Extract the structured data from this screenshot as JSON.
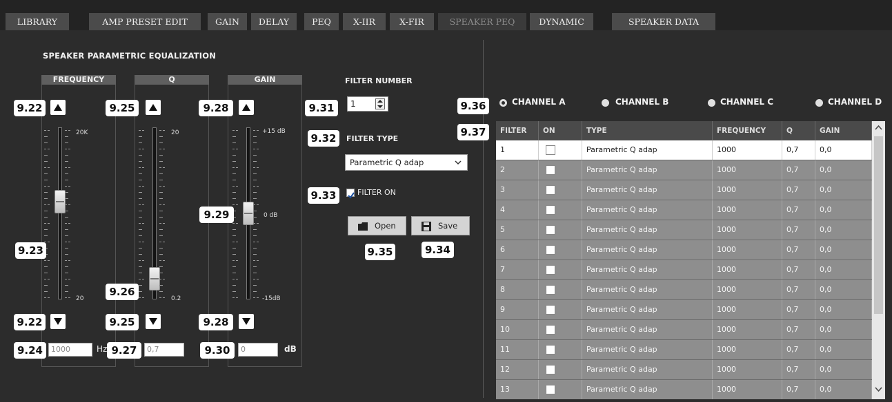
{
  "tabs": [
    {
      "label": "LIBRARY"
    },
    {
      "label": "AMP PRESET EDIT"
    },
    {
      "label": "GAIN"
    },
    {
      "label": "DELAY"
    },
    {
      "label": "PEQ"
    },
    {
      "label": "X-IIR"
    },
    {
      "label": "X-FIR"
    },
    {
      "label": "SPEAKER PEQ",
      "active": true
    },
    {
      "label": "DYNAMIC"
    },
    {
      "label": "SPEAKER DATA"
    }
  ],
  "section_title": "SPEAKER PARAMETRIC EQUALIZATION",
  "columns": {
    "frequency": {
      "header": "FREQUENCY",
      "scale_top": "20K",
      "scale_bottom": "20",
      "value": "1000",
      "unit": "Hz",
      "level": 0.58
    },
    "q": {
      "header": "Q",
      "scale_top": "20",
      "scale_bottom": "0.2",
      "value": "0,7",
      "unit": "",
      "level": 0.06
    },
    "gain": {
      "header": "GAIN",
      "scale_top": "+15 dB",
      "scale_mid": "0 dB",
      "scale_bottom": "-15dB",
      "value": "0",
      "unit": "dB",
      "level": 0.5
    }
  },
  "callouts": {
    "freq_up": "9.22",
    "freq_slider": "9.23",
    "freq_down": "9.22",
    "freq_value": "9.24",
    "q_up": "9.25",
    "q_slider": "9.26",
    "q_down": "9.25",
    "q_value": "9.27",
    "gain_up": "9.28",
    "gain_slider": "9.29",
    "gain_down": "9.28",
    "gain_value": "9.30",
    "filter_number": "9.31",
    "filter_type": "9.32",
    "filter_on": "9.33",
    "save": "9.34",
    "open": "9.35",
    "channels": "9.36",
    "table": "9.37"
  },
  "filter_number": {
    "label": "FILTER NUMBER",
    "value": "1"
  },
  "filter_type": {
    "label": "FILTER TYPE",
    "value": "Parametric Q adap"
  },
  "filter_on": {
    "label": "FILTER ON",
    "checked": true
  },
  "buttons": {
    "open": "Open",
    "save": "Save"
  },
  "channels": [
    {
      "label": "CHANNEL A",
      "selected": true
    },
    {
      "label": "CHANNEL B",
      "selected": false
    },
    {
      "label": "CHANNEL C",
      "selected": false
    },
    {
      "label": "CHANNEL D",
      "selected": false
    }
  ],
  "table": {
    "headers": [
      "FILTER",
      "ON",
      "TYPE",
      "FREQUENCY",
      "Q",
      "GAIN"
    ],
    "rows": [
      [
        "1",
        "",
        "Parametric Q adap",
        "1000",
        "0,7",
        "0,0"
      ],
      [
        "2",
        "",
        "Parametric Q adap",
        "1000",
        "0,7",
        "0,0"
      ],
      [
        "3",
        "",
        "Parametric Q adap",
        "1000",
        "0,7",
        "0,0"
      ],
      [
        "4",
        "",
        "Parametric Q adap",
        "1000",
        "0,7",
        "0,0"
      ],
      [
        "5",
        "",
        "Parametric Q adap",
        "1000",
        "0,7",
        "0,0"
      ],
      [
        "6",
        "",
        "Parametric Q adap",
        "1000",
        "0,7",
        "0,0"
      ],
      [
        "7",
        "",
        "Parametric Q adap",
        "1000",
        "0,7",
        "0,0"
      ],
      [
        "8",
        "",
        "Parametric Q adap",
        "1000",
        "0,7",
        "0,0"
      ],
      [
        "9",
        "",
        "Parametric Q adap",
        "1000",
        "0,7",
        "0,0"
      ],
      [
        "10",
        "",
        "Parametric Q adap",
        "1000",
        "0,7",
        "0,0"
      ],
      [
        "11",
        "",
        "Parametric Q adap",
        "1000",
        "0,7",
        "0,0"
      ],
      [
        "12",
        "",
        "Parametric Q adap",
        "1000",
        "0,7",
        "0,0"
      ],
      [
        "13",
        "",
        "Parametric Q adap",
        "1000",
        "0,7",
        "0,0"
      ]
    ],
    "selected_row": 0
  },
  "colors": {
    "background": "#2c2c2c",
    "tab": "#4b4b4b",
    "row": "#8e8e8e",
    "selected_row": "#ffffff"
  }
}
